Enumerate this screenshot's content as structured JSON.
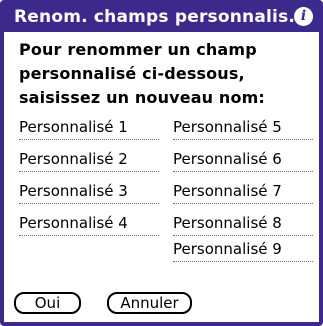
{
  "dialog": {
    "title": "Renom. champs personnalis.",
    "info_glyph": "i",
    "instructions": [
      "Pour renommer un champ",
      "personnalisé ci-dessous,",
      "saisissez un nouveau nom:"
    ],
    "fields_left": [
      "Personnalisé 1",
      "Personnalisé 2",
      "Personnalisé 3",
      "Personnalisé 4"
    ],
    "fields_right": [
      "Personnalisé 5",
      "Personnalisé 6",
      "Personnalisé 7",
      "Personnalisé 8",
      "Personnalisé 9"
    ],
    "buttons": {
      "ok": "Oui",
      "cancel": "Annuler"
    }
  },
  "colors": {
    "title_bar": "#3b2a8c",
    "background": "#ffffff",
    "text": "#000000"
  },
  "icons": {
    "info": "info-icon"
  }
}
